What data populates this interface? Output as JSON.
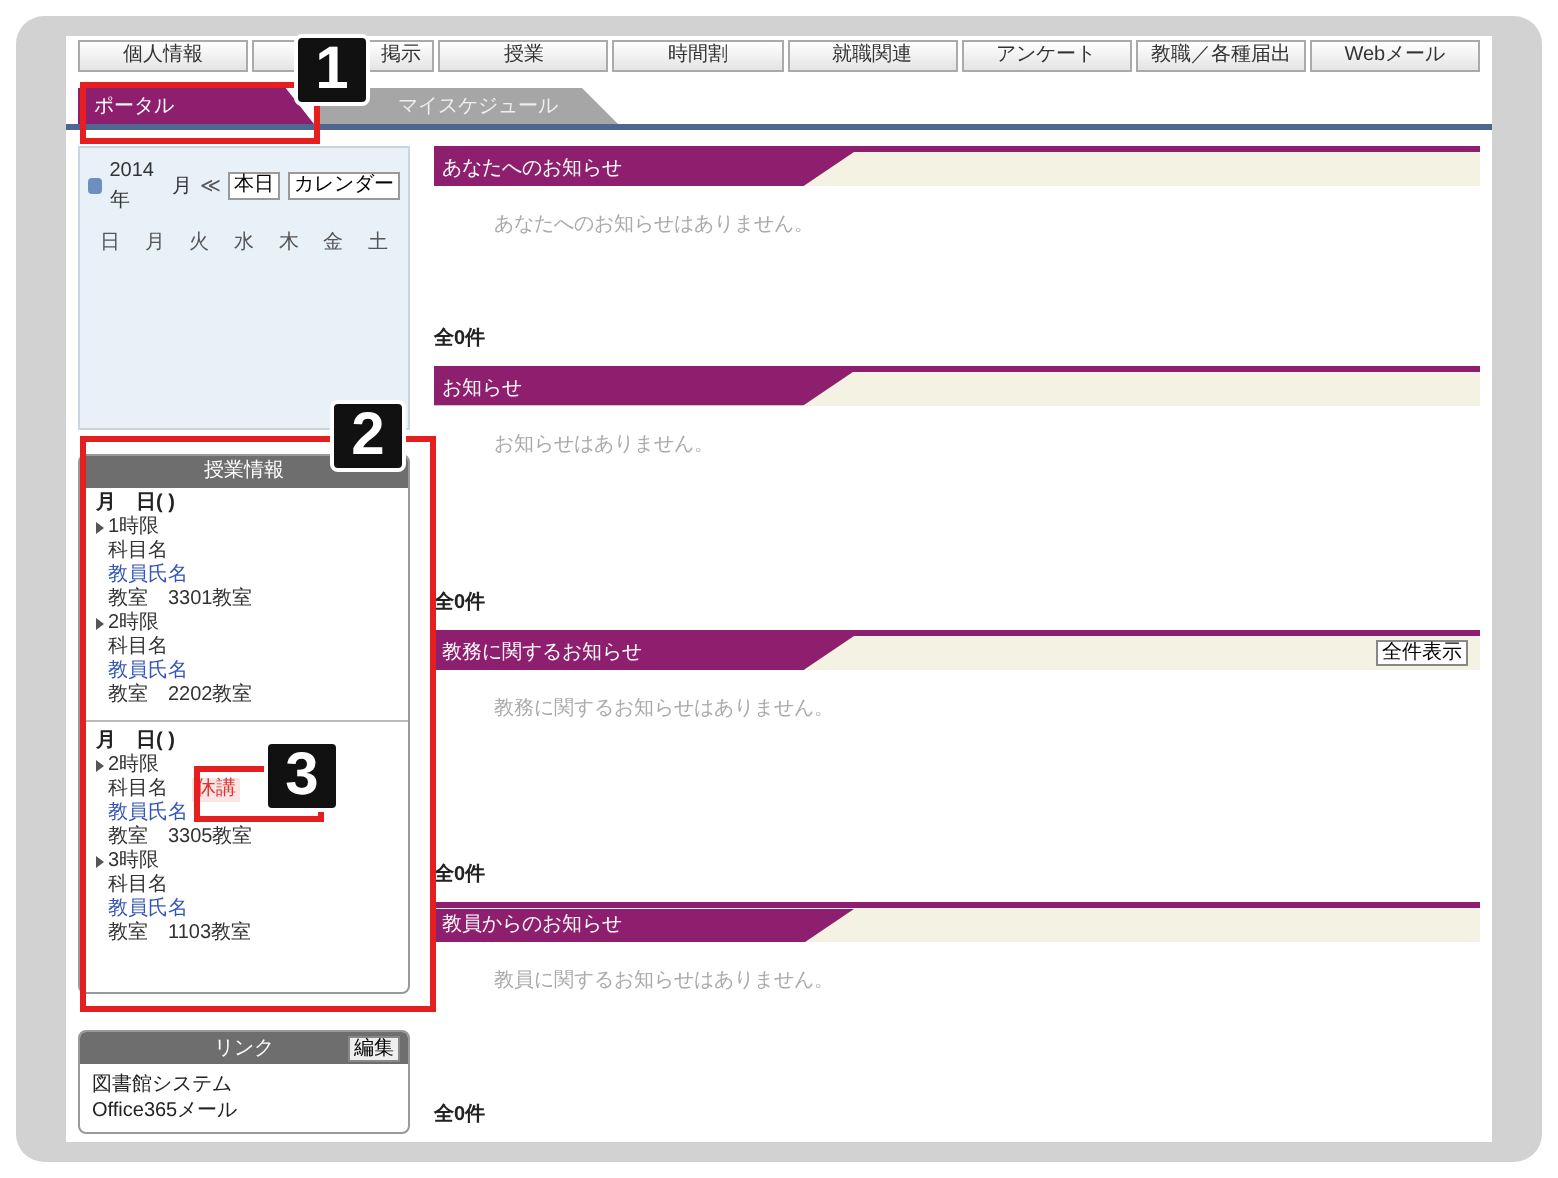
{
  "menu": [
    "個人情報",
    "掲示",
    "授業",
    "時間割",
    "就職関連",
    "アンケート",
    "教職／各種届出",
    "Webメール"
  ],
  "tabs": [
    {
      "label": "ポータル",
      "selected": true
    },
    {
      "label": "マイスケジュール",
      "selected": false
    }
  ],
  "calendar": {
    "year": "2014年",
    "month": "月",
    "nav": "≪",
    "buttons": [
      "本日",
      "カレンダー"
    ],
    "weekdays": [
      "日",
      "月",
      "火",
      "水",
      "木",
      "金",
      "土"
    ]
  },
  "lessons": {
    "title": "授業情報",
    "days": [
      {
        "date": "月　日( )",
        "periods": [
          {
            "period": "1時限",
            "subject": "科目名",
            "teacher": "教員氏名",
            "room": "教室　3301教室"
          },
          {
            "period": "2時限",
            "subject": "科目名",
            "teacher": "教員氏名",
            "room": "教室　2202教室"
          }
        ]
      },
      {
        "date": "月　日( )",
        "periods": [
          {
            "period": "2時限",
            "subject": "科目名",
            "badge": "休講",
            "teacher": "教員氏名",
            "room": "教室　3305教室"
          },
          {
            "period": "3時限",
            "subject": "科目名",
            "teacher": "教員氏名",
            "room": "教室　1103教室"
          }
        ]
      }
    ]
  },
  "links": {
    "title": "リンク",
    "edit_button": "編集",
    "items": [
      "図書館システム",
      "Office365メール"
    ]
  },
  "sections": [
    {
      "title": "あなたへのお知らせ",
      "message": "あなたへのお知らせはありません。",
      "count": "全0件"
    },
    {
      "title": "お知らせ",
      "message": "お知らせはありません。",
      "count": "全0件"
    },
    {
      "title": "教務に関するお知らせ",
      "button": "全件表示",
      "message": "教務に関するお知らせはありません。",
      "count": "全0件"
    },
    {
      "title": "教員からのお知らせ",
      "message": "教員に関するお知らせはありません。",
      "count": "全0件"
    }
  ],
  "callouts": [
    {
      "label": "1"
    },
    {
      "label": "2"
    },
    {
      "label": "3"
    }
  ]
}
